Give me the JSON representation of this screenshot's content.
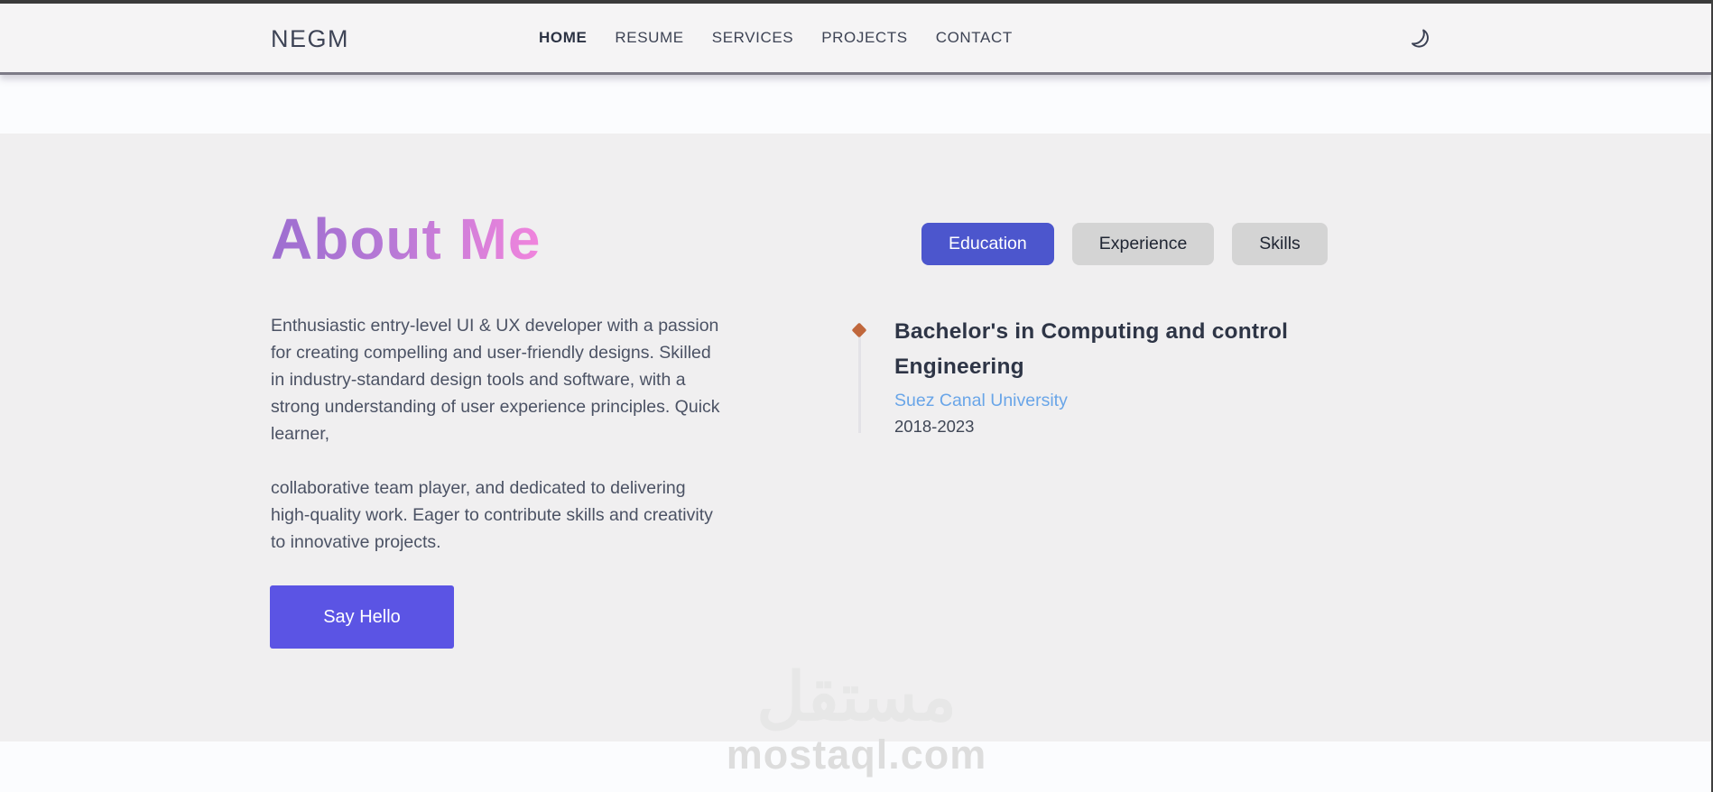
{
  "navbar": {
    "logo": "NEGM",
    "links": [
      {
        "label": "HOME",
        "active": true
      },
      {
        "label": "RESUME",
        "active": false
      },
      {
        "label": "SERVICES",
        "active": false
      },
      {
        "label": "PROJECTS",
        "active": false
      },
      {
        "label": "CONTACT",
        "active": false
      }
    ],
    "theme_toggle_icon": "moon-icon"
  },
  "about": {
    "title": "About Me",
    "paragraph1": "Enthusiastic entry-level UI & UX developer with a passion for creating compelling and user-friendly designs. Skilled in industry-standard design tools and software, with a strong understanding of user experience principles. Quick learner,",
    "paragraph2": "collaborative team player, and dedicated to delivering high-quality work. Eager to contribute skills and creativity to innovative projects.",
    "say_hello_label": "Say Hello"
  },
  "tabs": [
    {
      "label": "Education",
      "active": true
    },
    {
      "label": "Experience",
      "active": false
    },
    {
      "label": "Skills",
      "active": false
    }
  ],
  "education_entries": [
    {
      "degree": "Bachelor's in Computing and control Engineering",
      "institution": "Suez Canal University",
      "years": "2018-2023"
    }
  ],
  "watermark": {
    "arabic": "مستقل",
    "site": "mostaql.com"
  },
  "colors": {
    "accent_button": "#5b54e4",
    "active_tab": "#4c56cd",
    "inactive_tab": "#d4d4d4",
    "title_gradient_start": "#9d6ed0",
    "title_gradient_end": "#f185dd",
    "institution_link": "#69a5e8",
    "timeline_marker": "#c0673c",
    "section_background": "#f0eff0",
    "navbar_background": "#f5f4f5"
  }
}
